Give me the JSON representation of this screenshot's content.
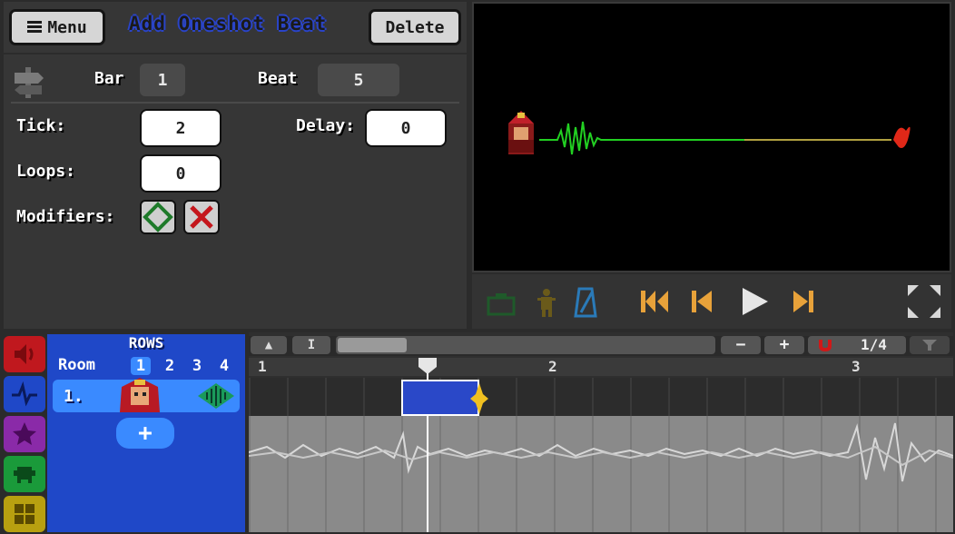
{
  "header": {
    "menu_label": "Menu",
    "title": "Add Oneshot Beat",
    "delete_label": "Delete"
  },
  "inspector": {
    "bar_label": "Bar",
    "bar_value": "1",
    "beat_label": "Beat",
    "beat_value": "5",
    "tick_label": "Tick:",
    "tick_value": "2",
    "delay_label": "Delay:",
    "delay_value": "0",
    "loops_label": "Loops:",
    "loops_value": "0",
    "modifiers_label": "Modifiers:"
  },
  "rows_panel": {
    "title": "ROWS",
    "room_label": "Room",
    "rooms": [
      "1",
      "2",
      "3",
      "4"
    ],
    "active_room": "1",
    "row1_label": "1.",
    "add_label": "+"
  },
  "timeline": {
    "zoom_label": "1/4",
    "bar_numbers": [
      "1",
      "2",
      "3"
    ]
  },
  "colors": {
    "rows_blue": "#1f48c8",
    "accent_orange": "#e8a23a",
    "title_blue": "#2a44c8",
    "wave_green": "#1ee01e",
    "tab_red": "#c0181e",
    "tab_blue": "#1f48c8",
    "tab_purple": "#8a2aa8",
    "tab_green": "#1a9a3a",
    "tab_yellow": "#b8a010"
  },
  "icons": {
    "menu": "hamburger-icon",
    "signpost": "signpost-icon",
    "modifier_add": "diamond-icon",
    "modifier_remove": "x-icon",
    "transport": [
      "game-icon",
      "character-icon",
      "metronome-icon",
      "skip-start-icon",
      "prev-icon",
      "play-icon",
      "next-icon",
      "fullscreen-icon"
    ]
  }
}
